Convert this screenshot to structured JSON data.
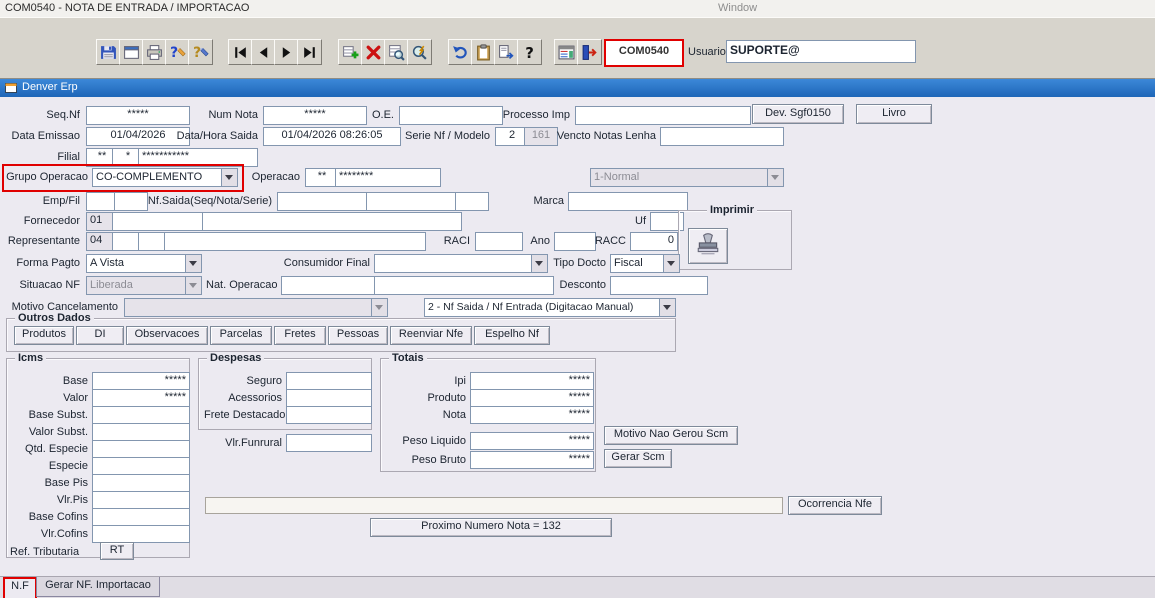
{
  "window": {
    "title": "COM0540 - NOTA DE ENTRADA / IMPORTACAO",
    "menu_item": "Window"
  },
  "toolbar": {
    "program_code": "COM0540",
    "user_label": "Usuario",
    "user_value": "SUPORTE@",
    "icons": [
      "save-icon",
      "window-icon",
      "print-icon",
      "help-edit-blue-icon",
      "help-edit-yellow-icon",
      "nav-first-icon",
      "nav-prev-icon",
      "nav-next-icon",
      "nav-last-icon",
      "insert-record-icon",
      "delete-record-icon",
      "enter-query-icon",
      "execute-query-icon",
      "undo-icon",
      "paste-icon",
      "transfer-icon",
      "help-icon",
      "memo-icon",
      "exit-icon"
    ]
  },
  "header": {
    "title": "Denver Erp"
  },
  "form": {
    "seq_nf_label": "Seq.Nf",
    "seq_nf_value": "*****",
    "num_nota_label": "Num Nota",
    "num_nota_value": "*****",
    "oe_label": "O.E.",
    "processo_imp_label": "Processo Imp",
    "dev_sgf_button": "Dev. Sgf0150",
    "livro_button": "Livro",
    "data_emissao_label": "Data Emissao",
    "data_emissao_value": "01/04/2026",
    "data_hora_saida_label": "Data/Hora Saida",
    "data_hora_saida_value": "01/04/2026 08:26:05",
    "serie_nf_label": "Serie Nf / Modelo",
    "serie_nf_value": "2",
    "modelo_value": "161",
    "vencto_label": "Vencto Notas Lenha",
    "filial_label": "Filial",
    "filial_v1": "**",
    "filial_v2": "*",
    "filial_v3": "***********",
    "grupo_operacao_label": "Grupo Operacao",
    "grupo_operacao_value": "CO-COMPLEMENTO",
    "operacao_label": "Operacao",
    "operacao_v1": "**",
    "operacao_v2": "********",
    "tipo_nota_value": "1-Normal",
    "emp_fil_label": "Emp/Fil",
    "nf_saida_label": "Nf.Saida(Seq/Nota/Serie)",
    "marca_label": "Marca",
    "fornecedor_label": "Fornecedor",
    "fornecedor_v1": "01",
    "uf_label": "Uf",
    "imprimir_title": "Imprimir",
    "representante_label": "Representante",
    "representante_v1": "04",
    "raci_label": "RACI",
    "ano_label": "Ano",
    "racc_label": "RACC",
    "racc_value": "0",
    "forma_pagto_label": "Forma Pagto",
    "forma_pagto_value": "A Vista",
    "consumidor_final_label": "Consumidor Final",
    "tipo_docto_label": "Tipo Docto",
    "tipo_docto_value": "Fiscal",
    "situacao_nf_label": "Situacao NF",
    "situacao_nf_value": "Liberada",
    "nat_operacao_label": "Nat. Operacao",
    "desconto_label": "Desconto",
    "motivo_cancelamento_label": "Motivo Cancelamento",
    "nf_entrada_tipo_value": "2 - Nf Saida / Nf Entrada (Digitacao Manual)"
  },
  "outros_dados": {
    "title": "Outros Dados",
    "buttons": [
      "Produtos",
      "DI",
      "Observacoes",
      "Parcelas",
      "Fretes",
      "Pessoas",
      "Reenviar Nfe",
      "Espelho Nf"
    ]
  },
  "icms": {
    "title": "Icms",
    "base_label": "Base",
    "base_value": "*****",
    "valor_label": "Valor",
    "valor_value": "*****",
    "base_subst_label": "Base Subst.",
    "valor_subst_label": "Valor Subst.",
    "qtd_especie_label": "Qtd. Especie",
    "especie_label": "Especie",
    "base_pis_label": "Base Pis",
    "vlr_pis_label": "Vlr.Pis",
    "base_cofins_label": "Base Cofins",
    "vlr_cofins_label": "Vlr.Cofins",
    "ref_tributaria_label": "Ref. Tributaria",
    "rt_button": "RT"
  },
  "despesas": {
    "title": "Despesas",
    "seguro_label": "Seguro",
    "acessorios_label": "Acessorios",
    "frete_destacado_label": "Frete Destacado",
    "vlr_funrural_label": "Vlr.Funrural"
  },
  "totais": {
    "title": "Totais",
    "ipi_label": "Ipi",
    "ipi_value": "*****",
    "produto_label": "Produto",
    "produto_value": "*****",
    "nota_label": "Nota",
    "nota_value": "*****",
    "peso_liquido_label": "Peso Liquido",
    "peso_liquido_value": "*****",
    "peso_bruto_label": "Peso Bruto",
    "peso_bruto_value": "*****"
  },
  "actions": {
    "motivo_nao_gerou_scm": "Motivo Nao Gerou Scm",
    "gerar_scm": "Gerar Scm",
    "ocorrencia_nfe": "Ocorrencia Nfe",
    "proximo_numero": "Proximo Numero Nota = 132"
  },
  "tabs": {
    "nf": "N.F",
    "gerar_nf": "Gerar NF. Importacao"
  },
  "colors": {
    "highlight_red": "#E00000",
    "header_blue": "#1E66B8",
    "form_bg": "#ECEAF1"
  }
}
